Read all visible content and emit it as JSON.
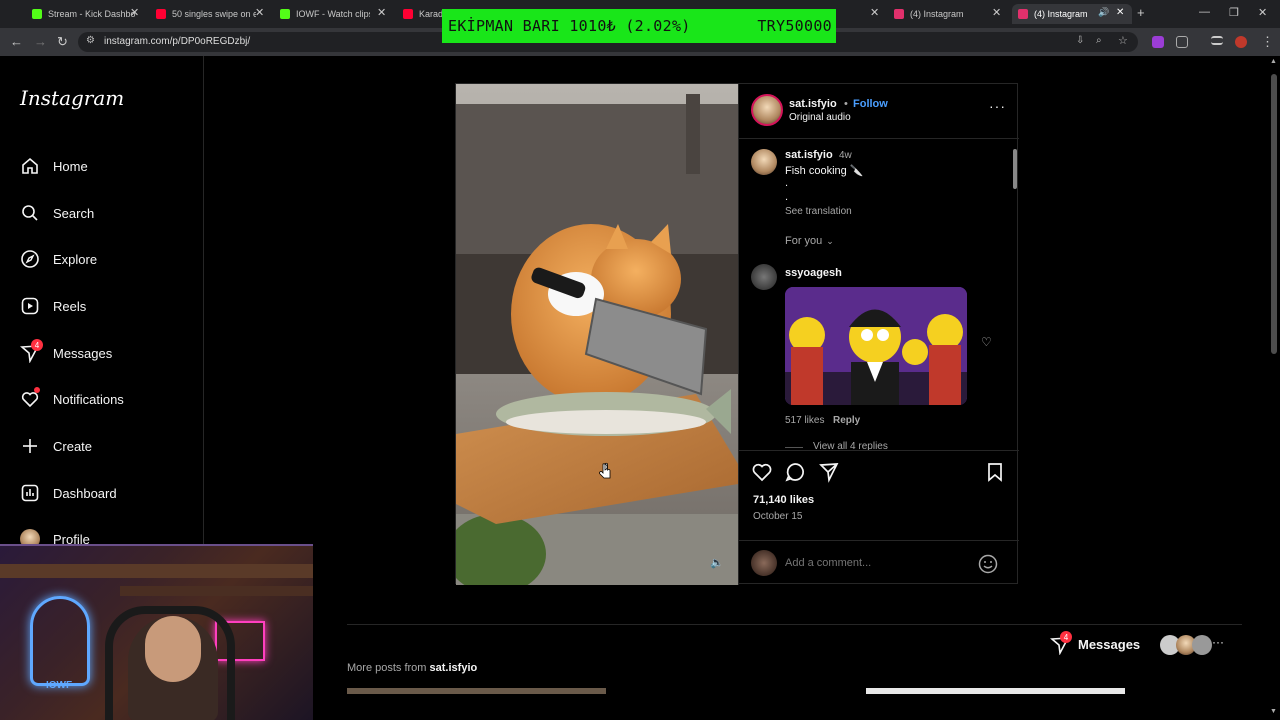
{
  "browser": {
    "tabs": [
      {
        "title": "Stream - Kick Dashbo",
        "icon": "kick-icon",
        "color": "#53fc18",
        "active": false
      },
      {
        "title": "50 singles swipe on e",
        "icon": "youtube-icon",
        "color": "#ff0033",
        "active": false
      },
      {
        "title": "IOWF - Watch clips on",
        "icon": "kick-icon",
        "color": "#53fc18",
        "active": false
      },
      {
        "title": "Karade",
        "icon": "youtube-icon",
        "color": "#ff0033",
        "active": false
      },
      {
        "title": "(4) Instagram",
        "icon": "instagram-icon",
        "color": "#e1306c",
        "active": false
      },
      {
        "title": "(4) Instagram",
        "icon": "instagram-icon",
        "color": "#e1306c",
        "active": true
      }
    ],
    "url": "instagram.com/p/DP0oREGDzbj/"
  },
  "overlay": {
    "left_text": "EKİPMAN BARI",
    "progress_text": "1010₺ (2.02%)",
    "goal_text": "TRY50000",
    "color": "#19e619"
  },
  "sidebar": {
    "logo": "Instagram",
    "items": [
      {
        "label": "Home",
        "icon": "home-icon"
      },
      {
        "label": "Search",
        "icon": "search-icon"
      },
      {
        "label": "Explore",
        "icon": "compass-icon"
      },
      {
        "label": "Reels",
        "icon": "reels-icon"
      },
      {
        "label": "Messages",
        "icon": "messenger-icon",
        "badge": "4"
      },
      {
        "label": "Notifications",
        "icon": "heart-icon",
        "dot": true
      },
      {
        "label": "Create",
        "icon": "plus-icon"
      },
      {
        "label": "Dashboard",
        "icon": "dashboard-icon"
      },
      {
        "label": "Profile",
        "icon": "avatar"
      }
    ]
  },
  "webcam": {
    "watermark": "IOWF"
  },
  "post": {
    "author": "sat.isfyio",
    "follow_label": "Follow",
    "audio": "Original audio",
    "more_label": "···",
    "caption": {
      "user": "sat.isfyio",
      "time": "4w",
      "text": "Fish cooking 🔪",
      "line2": ".",
      "line3": ".",
      "see_translation": "See translation"
    },
    "filter": "For you",
    "comment": {
      "user": "ssyoagesh",
      "likes": "517 likes",
      "reply_label": "Reply",
      "view_replies": "View all 4 replies"
    },
    "likes": "71,140 likes",
    "date": "October 15",
    "add_comment_placeholder": "Add a comment..."
  },
  "more_posts": {
    "prefix": "More posts from",
    "user": "sat.isfyio"
  },
  "messages_pill": {
    "label": "Messages",
    "badge": "4"
  },
  "colors": {
    "accent_blue": "#4a9eff",
    "badge_red": "#ff3040",
    "background": "#000000"
  }
}
